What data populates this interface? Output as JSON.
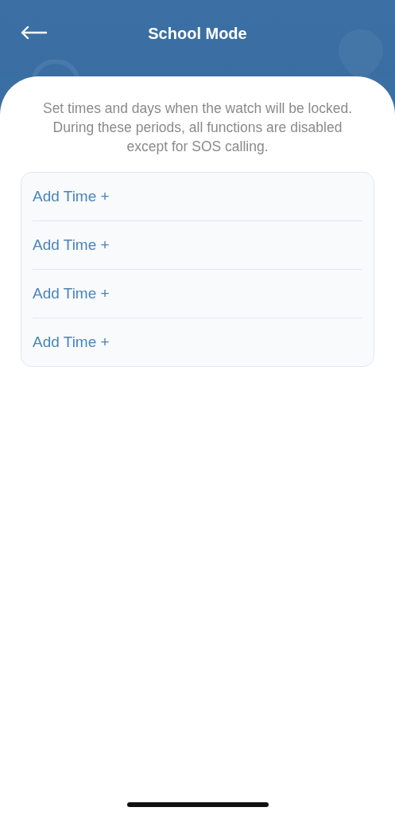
{
  "header": {
    "title": "School Mode"
  },
  "description": "Set times and days when the watch will be locked. During these periods, all functions are disabled except for SOS calling.",
  "time_slots": [
    {
      "label": "Add Time +"
    },
    {
      "label": "Add Time +"
    },
    {
      "label": "Add Time +"
    },
    {
      "label": "Add Time +"
    }
  ]
}
